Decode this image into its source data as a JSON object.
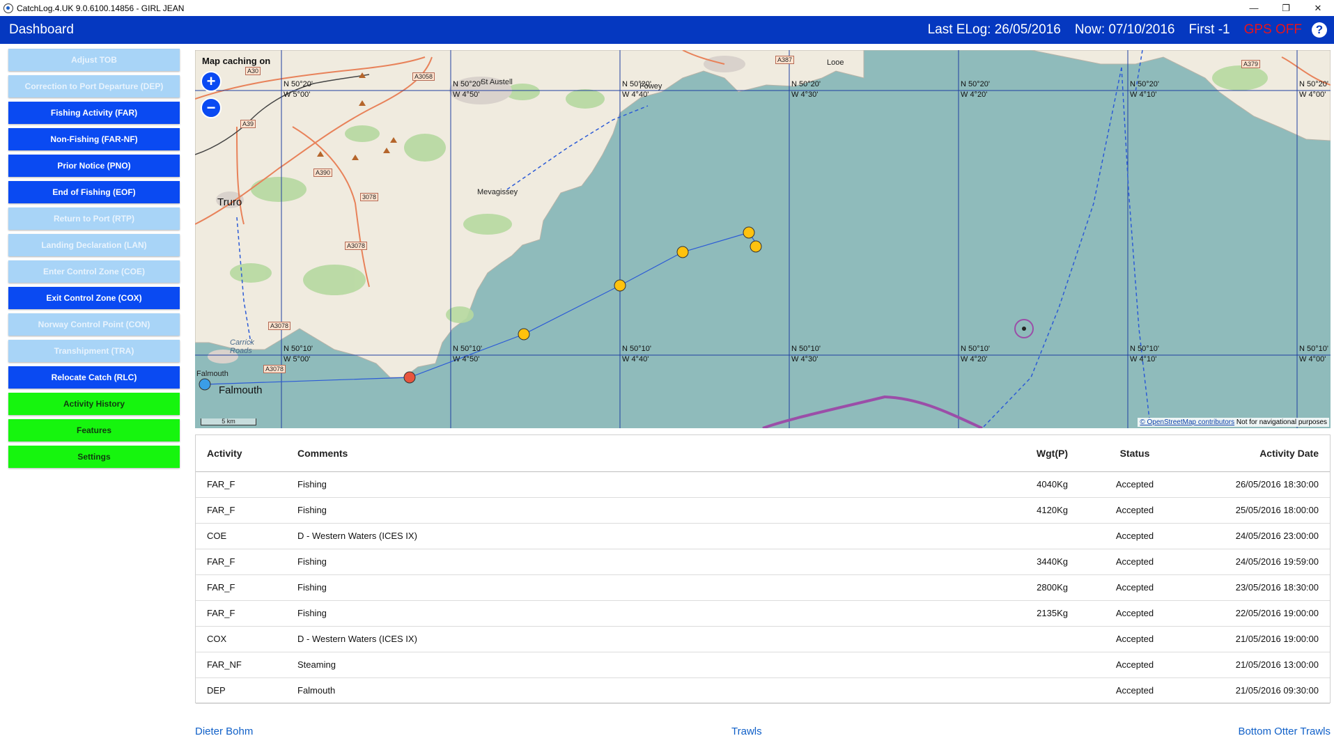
{
  "window": {
    "title": "CatchLog.4.UK 9.0.6100.14856  - GIRL JEAN",
    "minimize": "—",
    "restore": "❐",
    "close": "✕"
  },
  "header": {
    "title": "Dashboard",
    "last_elog": "Last ELog: 26/05/2016",
    "now": "Now: 07/10/2016",
    "first": "First -1",
    "gps": "GPS OFF",
    "help_icon": "?"
  },
  "sidebar": {
    "items": [
      {
        "label": "Adjust TOB",
        "state": "disabled"
      },
      {
        "label": "Correction to Port Departure (DEP)",
        "state": "disabled"
      },
      {
        "label": "Fishing Activity (FAR)",
        "state": "enabled"
      },
      {
        "label": "Non-Fishing (FAR-NF)",
        "state": "enabled"
      },
      {
        "label": "Prior Notice (PNO)",
        "state": "enabled"
      },
      {
        "label": "End of Fishing (EOF)",
        "state": "enabled"
      },
      {
        "label": "Return to Port (RTP)",
        "state": "disabled"
      },
      {
        "label": "Landing Declaration (LAN)",
        "state": "disabled"
      },
      {
        "label": "Enter Control Zone (COE)",
        "state": "disabled"
      },
      {
        "label": "Exit Control Zone (COX)",
        "state": "enabled"
      },
      {
        "label": "Norway Control Point (CON)",
        "state": "disabled"
      },
      {
        "label": "Transhipment (TRA)",
        "state": "disabled"
      },
      {
        "label": "Relocate Catch (RLC)",
        "state": "enabled"
      },
      {
        "label": "Activity History",
        "state": "green"
      },
      {
        "label": "Features",
        "state": "green"
      },
      {
        "label": "Settings",
        "state": "green"
      }
    ]
  },
  "map": {
    "caching_label": "Map caching on",
    "zoom_in": "+",
    "zoom_out": "−",
    "attribution_link": "© OpenStreetMap contributors",
    "attribution_note": "Not for navigational purposes",
    "scale_label": "5 km",
    "grid_top": [
      {
        "lat": "N 50°20'",
        "lon": "W 5°00'"
      },
      {
        "lat": "N 50°20'",
        "lon": "W 4°50'"
      },
      {
        "lat": "N 50°20'",
        "lon": "W 4°40'"
      },
      {
        "lat": "N 50°20'",
        "lon": "W 4°30'"
      },
      {
        "lat": "N 50°20'",
        "lon": "W 4°20'"
      },
      {
        "lat": "N 50°20'",
        "lon": "W 4°10'"
      },
      {
        "lat": "N 50°20'",
        "lon": "W 4°00'"
      }
    ],
    "grid_bottom": [
      {
        "lat": "N 50°10'",
        "lon": "W 5°00'"
      },
      {
        "lat": "N 50°10'",
        "lon": "W 4°50'"
      },
      {
        "lat": "N 50°10'",
        "lon": "W 4°40'"
      },
      {
        "lat": "N 50°10'",
        "lon": "W 4°30'"
      },
      {
        "lat": "N 50°10'",
        "lon": "W 4°20'"
      },
      {
        "lat": "N 50°10'",
        "lon": "W 4°10'"
      },
      {
        "lat": "N 50°10'",
        "lon": "W 4°00'"
      }
    ],
    "places": {
      "truro": "Truro",
      "mevagissey": "Mevagissey",
      "st_austell": "St Austell",
      "fowey": "Fowey",
      "looe": "Looe",
      "falmouth_small": "Falmouth",
      "falmouth_big": "Falmouth",
      "carrick_roads": "Carrick Roads"
    },
    "roads": {
      "a30": "A30",
      "a3058": "A3058",
      "a39": "A39",
      "a390": "A390",
      "r3078": "3078",
      "a3078": "A3078",
      "a3078b": "A3078",
      "a3078c": "A3078",
      "a387": "A387",
      "a379": "A379"
    },
    "colors": {
      "sea": "#8fbbbb",
      "land": "#f0ebdf",
      "track": "#2c5bd6",
      "marker": "#ffc20e",
      "start_marker": "#e8553d",
      "port_marker": "#3a9de8"
    }
  },
  "table": {
    "headers": {
      "activity": "Activity",
      "comments": "Comments",
      "weight": "Wgt(P)",
      "status": "Status",
      "date": "Activity Date"
    },
    "rows": [
      {
        "activity": "FAR_F",
        "comments": "Fishing",
        "weight": "4040Kg",
        "status": "Accepted",
        "date": "26/05/2016 18:30:00"
      },
      {
        "activity": "FAR_F",
        "comments": "Fishing",
        "weight": "4120Kg",
        "status": "Accepted",
        "date": "25/05/2016 18:00:00"
      },
      {
        "activity": "COE",
        "comments": "D - Western Waters (ICES IX)",
        "weight": "",
        "status": "Accepted",
        "date": "24/05/2016 23:00:00"
      },
      {
        "activity": "FAR_F",
        "comments": "Fishing",
        "weight": "3440Kg",
        "status": "Accepted",
        "date": "24/05/2016 19:59:00"
      },
      {
        "activity": "FAR_F",
        "comments": "Fishing",
        "weight": "2800Kg",
        "status": "Accepted",
        "date": "23/05/2016 18:30:00"
      },
      {
        "activity": "FAR_F",
        "comments": "Fishing",
        "weight": "2135Kg",
        "status": "Accepted",
        "date": "22/05/2016 19:00:00"
      },
      {
        "activity": "COX",
        "comments": "D - Western Waters (ICES IX)",
        "weight": "",
        "status": "Accepted",
        "date": "21/05/2016 19:00:00"
      },
      {
        "activity": "FAR_NF",
        "comments": "Steaming",
        "weight": "",
        "status": "Accepted",
        "date": "21/05/2016 13:00:00"
      },
      {
        "activity": "DEP",
        "comments": "Falmouth",
        "weight": "",
        "status": "Accepted",
        "date": "21/05/2016 09:30:00"
      }
    ]
  },
  "footer": {
    "left": "Dieter Bohm",
    "center": "Trawls",
    "right": "Bottom Otter Trawls"
  }
}
